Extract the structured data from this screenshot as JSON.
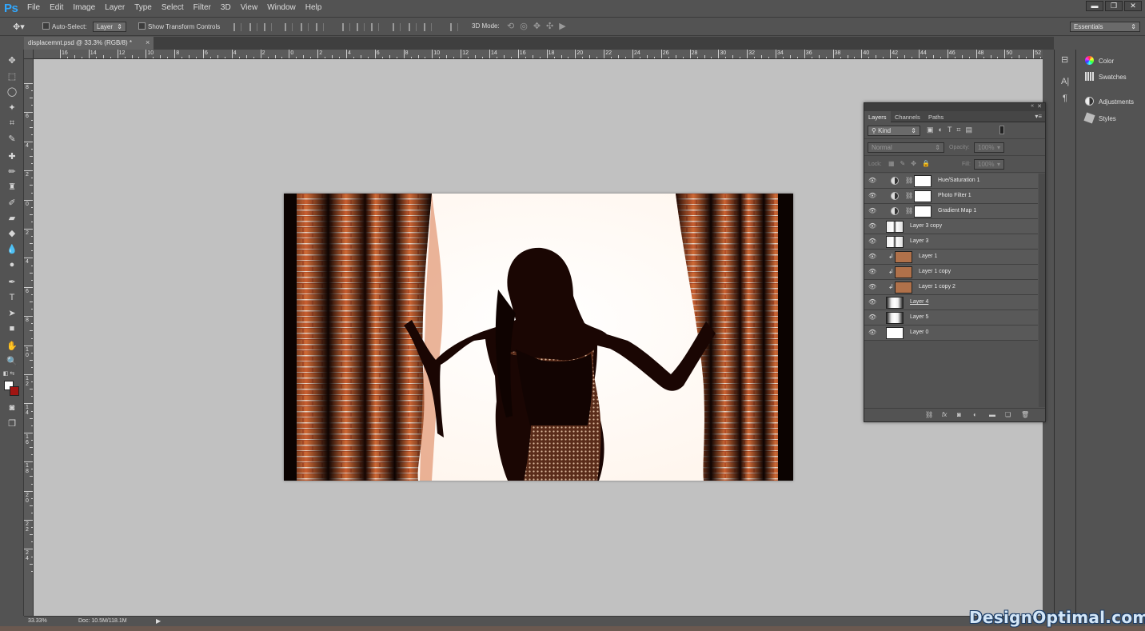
{
  "app": {
    "logo": "Ps"
  },
  "menu": [
    "File",
    "Edit",
    "Image",
    "Layer",
    "Type",
    "Select",
    "Filter",
    "3D",
    "View",
    "Window",
    "Help"
  ],
  "window_controls": {
    "minimize": "▬",
    "restore": "❐",
    "close": "✕"
  },
  "options_bar": {
    "auto_select_label": "Auto-Select:",
    "auto_select_target": "Layer",
    "show_transform_label": "Show Transform Controls",
    "mode_3d_label": "3D Mode:",
    "workspace": "Essentials"
  },
  "document_tab": {
    "title": "displacemnt.psd @ 33.3% (RGB/8) *",
    "close": "×"
  },
  "ruler_top_labels": [
    "16",
    "14",
    "12",
    "10",
    "8",
    "6",
    "4",
    "2",
    "0",
    "2",
    "4",
    "6",
    "8",
    "10",
    "12",
    "14",
    "16",
    "18",
    "20",
    "22",
    "24",
    "26",
    "28",
    "30",
    "32",
    "34",
    "36",
    "38",
    "40",
    "42",
    "44",
    "46",
    "48",
    "50",
    "52"
  ],
  "ruler_left_labels": [
    "8",
    "6",
    "4",
    "2",
    "0",
    "2",
    "4",
    "6",
    "8",
    "10",
    "12",
    "14",
    "16",
    "18",
    "20",
    "22",
    "24"
  ],
  "dock": {
    "items": [
      {
        "label": "Color",
        "icon": "color-wheel-icon"
      },
      {
        "label": "Swatches",
        "icon": "grid-icon"
      },
      {
        "label": "Adjustments",
        "icon": "half-circle-icon"
      },
      {
        "label": "Styles",
        "icon": "styles-icon"
      }
    ]
  },
  "layers_panel": {
    "tabs": [
      "Layers",
      "Channels",
      "Paths"
    ],
    "filter_kind": "Kind",
    "blend_mode": "Normal",
    "opacity_label": "Opacity:",
    "opacity_value": "100%",
    "lock_label": "Lock:",
    "fill_label": "Fill:",
    "fill_value": "100%",
    "layers": [
      {
        "name": "Hue/Saturation 1",
        "type": "adjustment",
        "visible": true
      },
      {
        "name": "Photo Filter 1",
        "type": "adjustment",
        "visible": true
      },
      {
        "name": "Gradient Map 1",
        "type": "adjustment",
        "visible": true
      },
      {
        "name": "Layer 3 copy",
        "type": "photo",
        "visible": true
      },
      {
        "name": "Layer 3",
        "type": "photo",
        "visible": true
      },
      {
        "name": "Layer 1",
        "type": "brick-clipped",
        "visible": true
      },
      {
        "name": "Layer 1 copy",
        "type": "brick-clipped",
        "visible": true
      },
      {
        "name": "Layer 1 copy 2",
        "type": "brick-clipped",
        "visible": true
      },
      {
        "name": "Layer 4",
        "type": "photo-dark",
        "visible": true
      },
      {
        "name": "Layer 5",
        "type": "photo-dark",
        "visible": true
      },
      {
        "name": "Layer 0",
        "type": "white",
        "visible": true
      }
    ]
  },
  "status": {
    "zoom": "33.33%",
    "doc": "Doc: 10.5M/118.1M",
    "arrow": "▶"
  },
  "watermark": "DesignOptimal.com",
  "colors": {
    "foreground": "#ffffff",
    "background": "#a11512",
    "ps_blue": "#31a8ff"
  }
}
